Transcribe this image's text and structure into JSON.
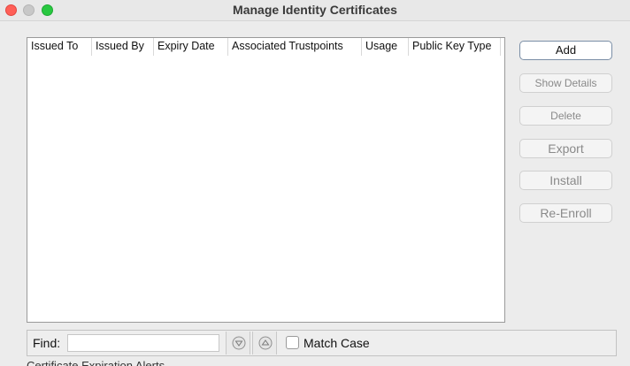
{
  "window": {
    "title": "Manage Identity Certificates"
  },
  "table": {
    "columns": [
      "Issued To",
      "Issued By",
      "Expiry Date",
      "Associated Trustpoints",
      "Usage",
      "Public Key Type"
    ],
    "rows": []
  },
  "actions": {
    "add": "Add",
    "show_details": "Show Details",
    "delete": "Delete",
    "export": "Export",
    "install": "Install",
    "re_enroll": "Re-Enroll"
  },
  "find": {
    "label": "Find:",
    "value": "",
    "match_case_label": "Match Case",
    "match_case_checked": false
  },
  "footer": {
    "partial_text": "Certificate Expiration Alerts"
  }
}
